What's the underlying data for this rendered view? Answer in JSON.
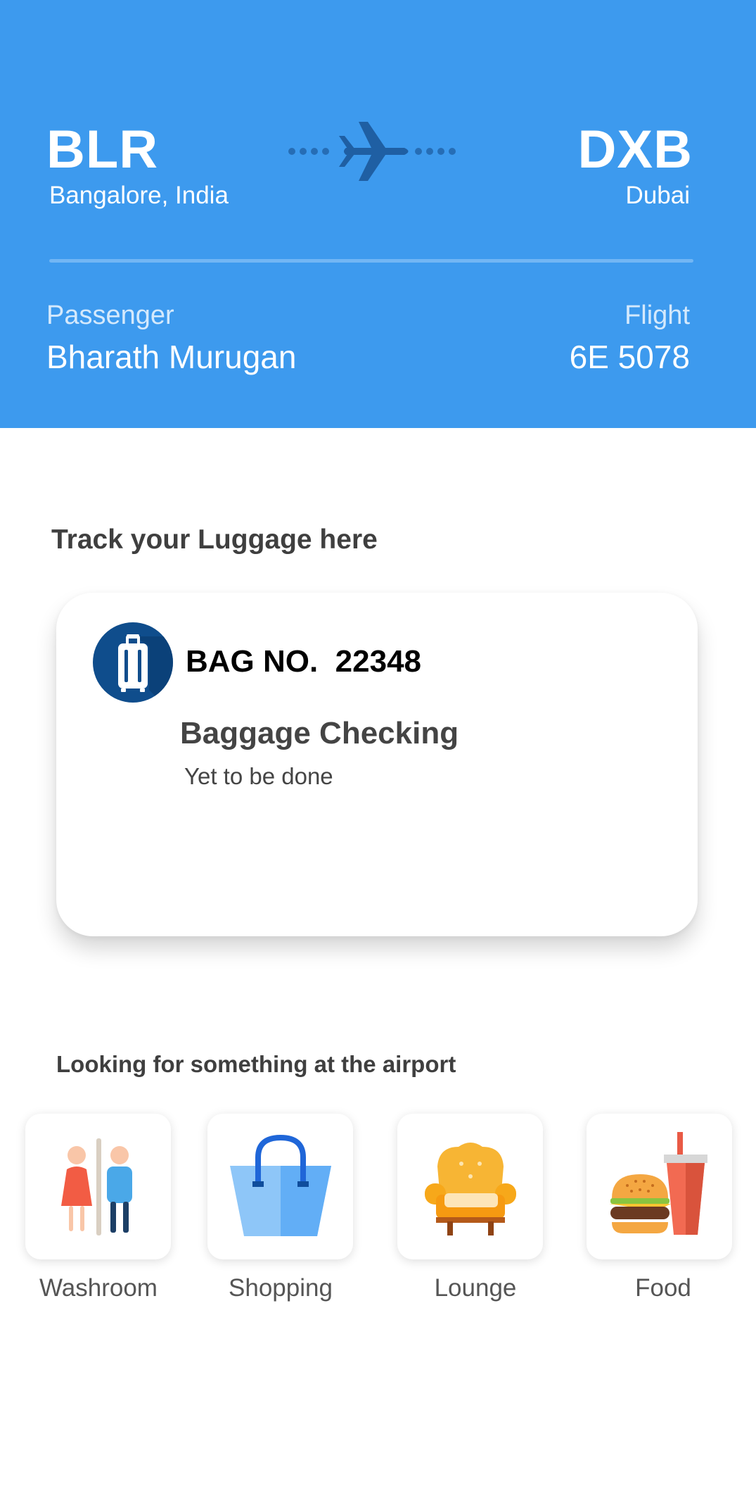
{
  "flight": {
    "origin_code": "BLR",
    "origin_city": "Bangalore, India",
    "destination_code": "DXB",
    "destination_city": "Dubai",
    "passenger_label": "Passenger",
    "passenger_name": "Bharath Murugan",
    "flight_label": "Flight",
    "flight_number": "6E 5078"
  },
  "luggage": {
    "section_title": "Track your Luggage here",
    "bag_number": "BAG NO.  22348",
    "status_title": "Baggage Checking",
    "status_text": "Yet to be done"
  },
  "airport": {
    "section_title": "Looking for something at the airport",
    "categories": [
      {
        "label": "Washroom",
        "icon": "washroom-icon"
      },
      {
        "label": "Shopping",
        "icon": "shopping-bag-icon"
      },
      {
        "label": "Lounge",
        "icon": "armchair-icon"
      },
      {
        "label": "Food",
        "icon": "burger-drink-icon"
      }
    ]
  },
  "colors": {
    "header_background": "#3d9aee",
    "route_icon": "#1f5fa3",
    "bag_icon_circle": "#0f4d8c"
  }
}
